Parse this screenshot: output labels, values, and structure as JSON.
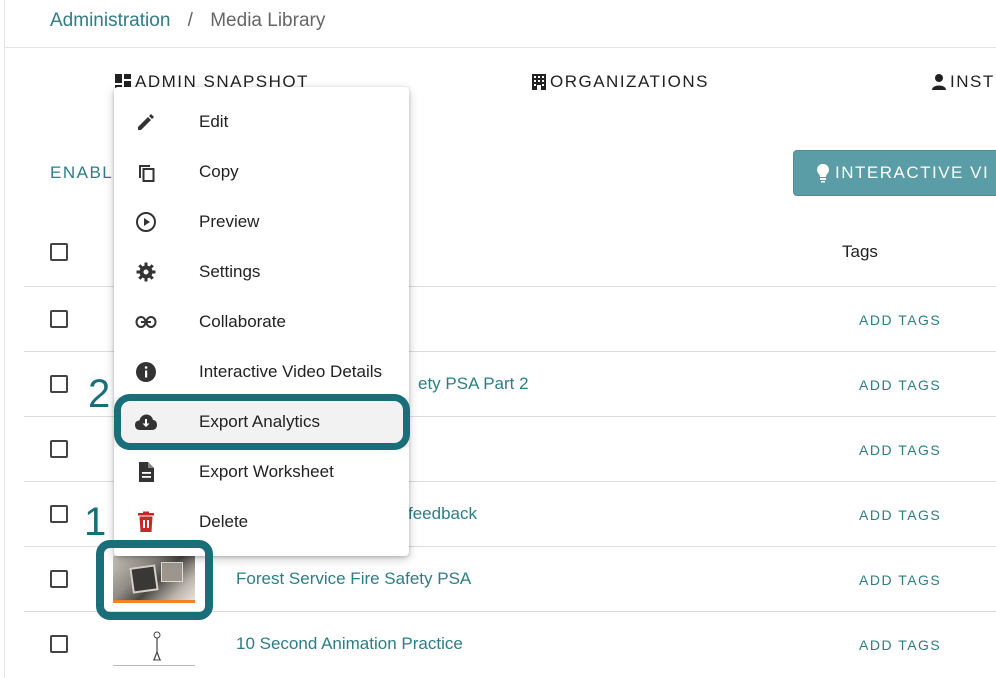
{
  "breadcrumb": {
    "root": "Administration",
    "separator": "/",
    "current": "Media Library"
  },
  "tabs": [
    {
      "label": "ADMIN SNAPSHOT",
      "icon": "dashboard-icon"
    },
    {
      "label": "ORGANIZATIONS",
      "icon": "building-icon"
    },
    {
      "label": "INST",
      "icon": "person-icon"
    }
  ],
  "toolbar": {
    "enable_label": "ENABL",
    "interactive_video_label": "INTERACTIVE VI"
  },
  "table": {
    "tags_header": "Tags",
    "rows": [
      {
        "title": "",
        "add_tags": "ADD TAGS"
      },
      {
        "title": "ety PSA Part 2",
        "add_tags": "ADD TAGS"
      },
      {
        "title": "",
        "add_tags": "ADD TAGS"
      },
      {
        "title": "feedback",
        "add_tags": "ADD TAGS"
      },
      {
        "title": "Forest Service Fire Safety PSA",
        "add_tags": "ADD TAGS"
      },
      {
        "title": "10 Second Animation Practice",
        "add_tags": "ADD TAGS"
      }
    ]
  },
  "menu": {
    "items": [
      {
        "label": "Edit",
        "icon": "pencil-icon"
      },
      {
        "label": "Copy",
        "icon": "copy-icon"
      },
      {
        "label": "Preview",
        "icon": "play-circle-icon"
      },
      {
        "label": "Settings",
        "icon": "gear-icon"
      },
      {
        "label": "Collaborate",
        "icon": "link-icon"
      },
      {
        "label": "Interactive Video Details",
        "icon": "info-icon"
      },
      {
        "label": "Export Analytics",
        "icon": "cloud-download-icon"
      },
      {
        "label": "Export Worksheet",
        "icon": "document-icon"
      },
      {
        "label": "Delete",
        "icon": "trash-icon"
      }
    ]
  },
  "annotations": {
    "step1": "1",
    "step2": "2"
  },
  "colors": {
    "accent": "#2e7d86",
    "highlight": "#1a6e7a",
    "button": "#5b9da6",
    "delete": "#c62828",
    "thumb_border": "#f5821f"
  }
}
